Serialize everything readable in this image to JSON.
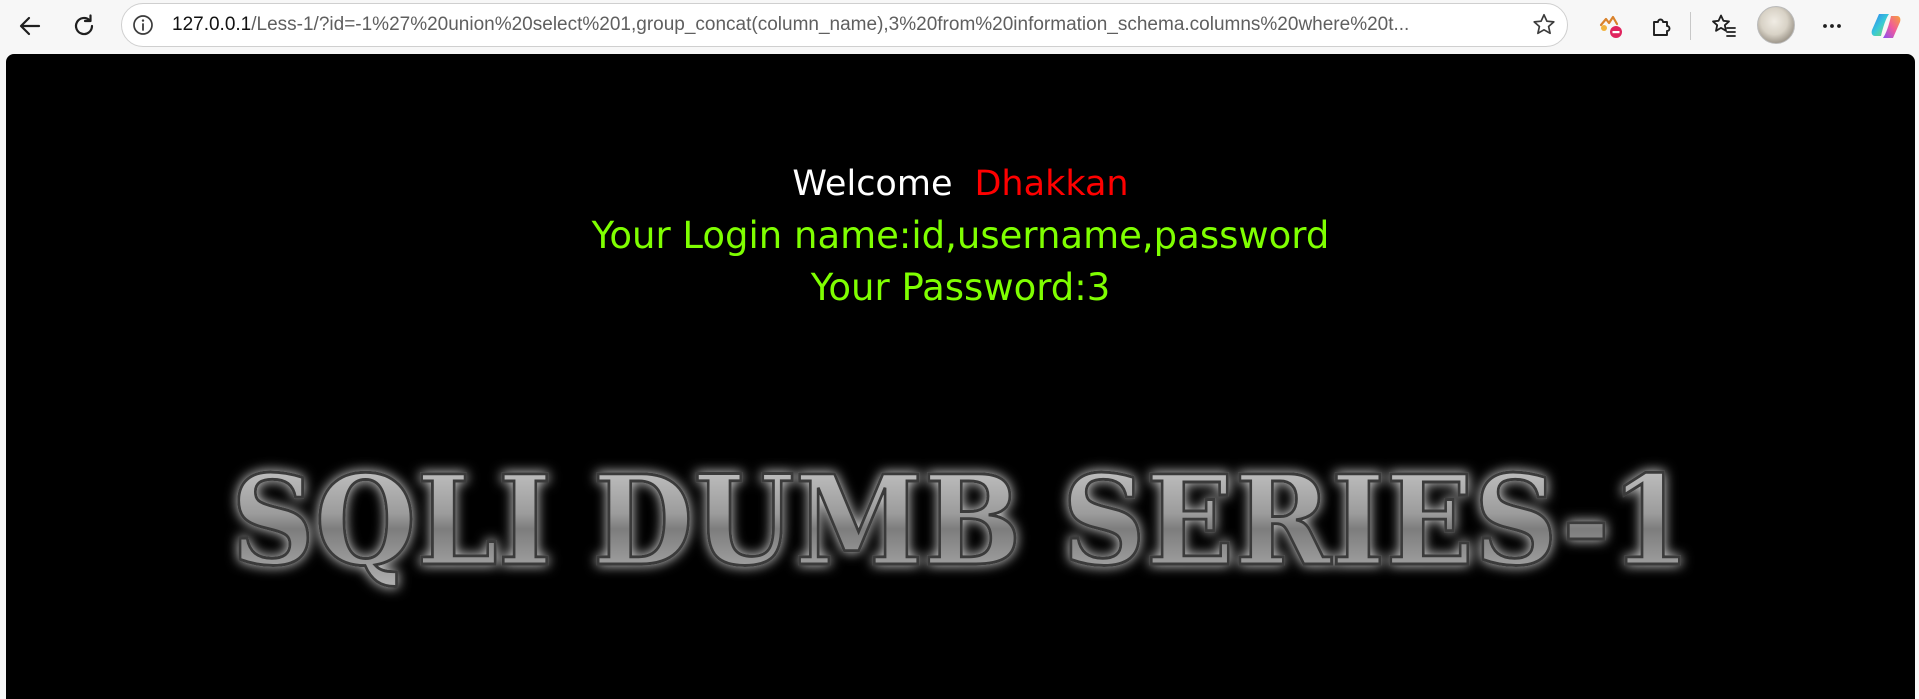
{
  "browser": {
    "url_host": "127.0.0.1",
    "url_rest": "/Less-1/?id=-1%27%20union%20select%201,group_concat(column_name),3%20from%20information_schema.columns%20where%20t..."
  },
  "page": {
    "welcome_word": "Welcome",
    "welcome_name": "Dhakkan",
    "login_line": "Your Login name:id,username,password",
    "password_line": "Your Password:3",
    "banner_text": "SQLI DUMB SERIES-1"
  },
  "colors": {
    "page_background": "#000000",
    "welcome_text": "#ffffff",
    "name_text": "#ff0000",
    "result_text": "#7fff00"
  },
  "icons": [
    "back-arrow-icon",
    "refresh-icon",
    "info-icon",
    "star-icon",
    "extension-blocked-icon",
    "extensions-puzzle-icon",
    "favorites-icon",
    "menu-more-icon",
    "copilot-icon"
  ]
}
